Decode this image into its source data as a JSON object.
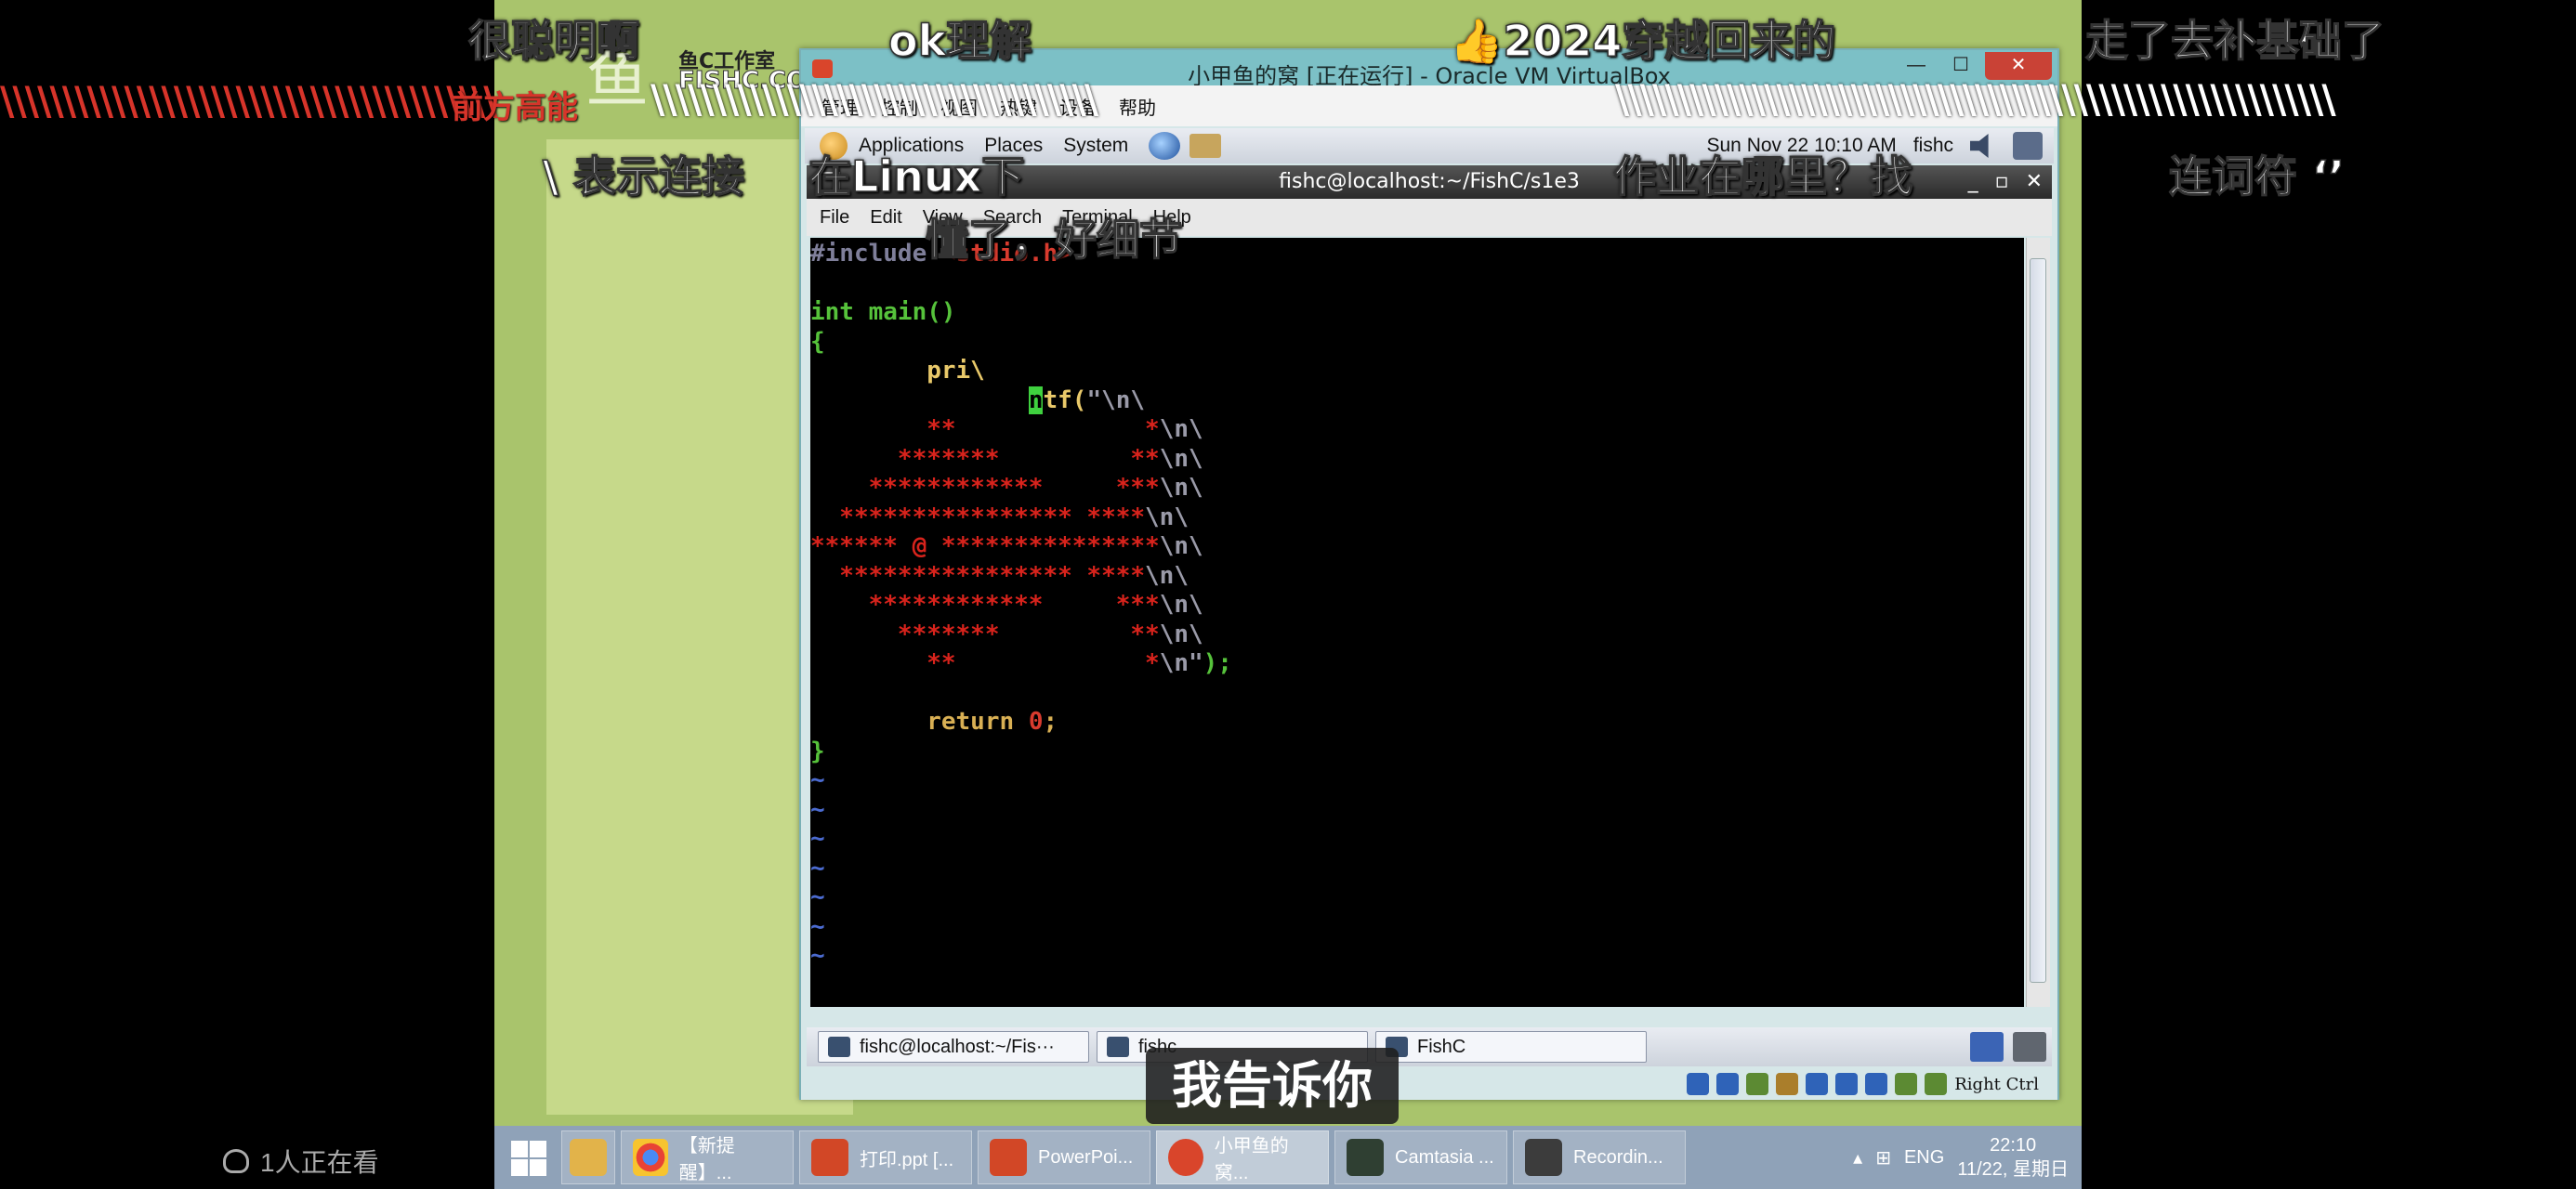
{
  "logo": {
    "title": "鱼C工作室",
    "sub": "FISHC.COM"
  },
  "vbox": {
    "title": "小甲鱼的窝 [正在运行] - Oracle VM VirtualBox",
    "menu": [
      "管理",
      "控制",
      "视图",
      "热键",
      "设备",
      "帮助"
    ],
    "controls": {
      "minimize": "—",
      "maximize": "☐",
      "close": "✕"
    },
    "status": {
      "host_key": "Right Ctrl"
    }
  },
  "guest_panel": {
    "items": [
      "Applications",
      "Places",
      "System"
    ],
    "clock": "Sun Nov 22 10:10 AM",
    "user": "fishc"
  },
  "terminal": {
    "title": "fishc@localhost:~/FishC/s1e3",
    "menu": [
      "File",
      "Edit",
      "View",
      "Search",
      "Terminal",
      "Help"
    ],
    "controls": {
      "minimize": "_",
      "maximize": "▫",
      "close": "✕"
    }
  },
  "guest_bottom": {
    "tasks": [
      "fishc@localhost:~/Fis···",
      "fishc",
      "FishC"
    ]
  },
  "host_taskbar": {
    "items": [
      "【新提醒】...",
      "打印.ppt [...",
      "PowerPoi...",
      "小甲鱼的窝...",
      "Camtasia ...",
      "Recordin..."
    ],
    "lang": "ENG",
    "time": "22:10",
    "date": "11/22, 星期日"
  },
  "colors": {
    "terminal_bg": "#000000",
    "vbox_title": "#7cc0c6",
    "taskbar": "#8fa2b8",
    "danmaku_red": "#d7342a"
  },
  "danmaku": [
    "很聪明啊",
    "ok理解",
    "👍2024穿越回来的",
    "走了去补基础了",
    "前方高能",
    "\\ 表示连接",
    "在Linux下",
    "作业在哪里？找",
    "连词符 ‘’",
    "懂了，好细节"
  ],
  "subtitle": "我告诉你",
  "viewers": "1人正在看"
}
